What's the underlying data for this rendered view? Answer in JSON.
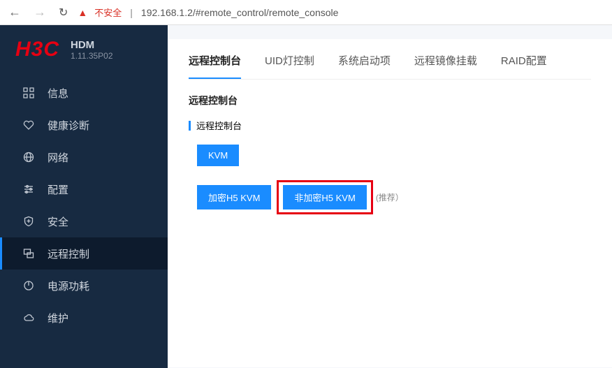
{
  "browser": {
    "insecure_label": "不安全",
    "url": "192.168.1.2/#remote_control/remote_console"
  },
  "header": {
    "logo": "H3C",
    "product": "HDM",
    "version": "1.11.35P02"
  },
  "sidebar": {
    "items": [
      {
        "label": "信息"
      },
      {
        "label": "健康诊断"
      },
      {
        "label": "网络"
      },
      {
        "label": "配置"
      },
      {
        "label": "安全"
      },
      {
        "label": "远程控制"
      },
      {
        "label": "电源功耗"
      },
      {
        "label": "维护"
      }
    ]
  },
  "tabs": [
    {
      "label": "远程控制台"
    },
    {
      "label": "UID灯控制"
    },
    {
      "label": "系统启动项"
    },
    {
      "label": "远程镜像挂载"
    },
    {
      "label": "RAID配置"
    }
  ],
  "main": {
    "section_title": "远程控制台",
    "sub_title": "远程控制台",
    "kvm_btn": "KVM",
    "enc_h5_btn": "加密H5 KVM",
    "nonenc_h5_btn": "非加密H5 KVM",
    "recommend": "(推荐）"
  }
}
